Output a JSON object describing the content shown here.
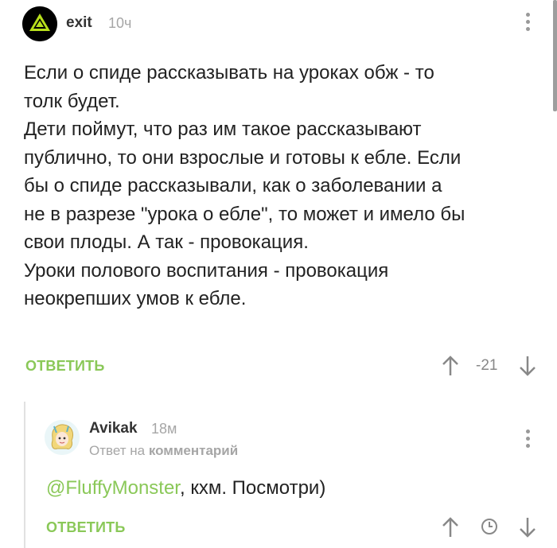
{
  "comment": {
    "author": "exit",
    "time": "10ч",
    "avatar_icon": "green-triangle-logo",
    "text_lines": [
      "Если о спиде рассказывать на уроках обж - то",
      "толк будет.",
      "Дети поймут, что раз им такое рассказывают",
      "публично, то они взрослые и готовы к ебле. Если",
      "бы о спиде рассказывали, как о заболевании а",
      "не в разрезе \"урока о ебле\", то может и имело бы",
      "свои плоды. А так - провокация.",
      "Уроки полового воспитания - провокация",
      "неокрепших умов к ебле."
    ],
    "reply_label": "ОТВЕТИТЬ",
    "score": "-21"
  },
  "reply": {
    "author": "Avikak",
    "time": "18м",
    "reply_prefix": "Ответ на",
    "reply_target": "комментарий",
    "mention": "@FluffyMonster",
    "text_rest": ", кхм. Посмотри)",
    "reply_label": "ОТВЕТИТЬ"
  },
  "colors": {
    "accent": "#8ac858",
    "muted": "#a6a6a6",
    "text": "#222222"
  }
}
